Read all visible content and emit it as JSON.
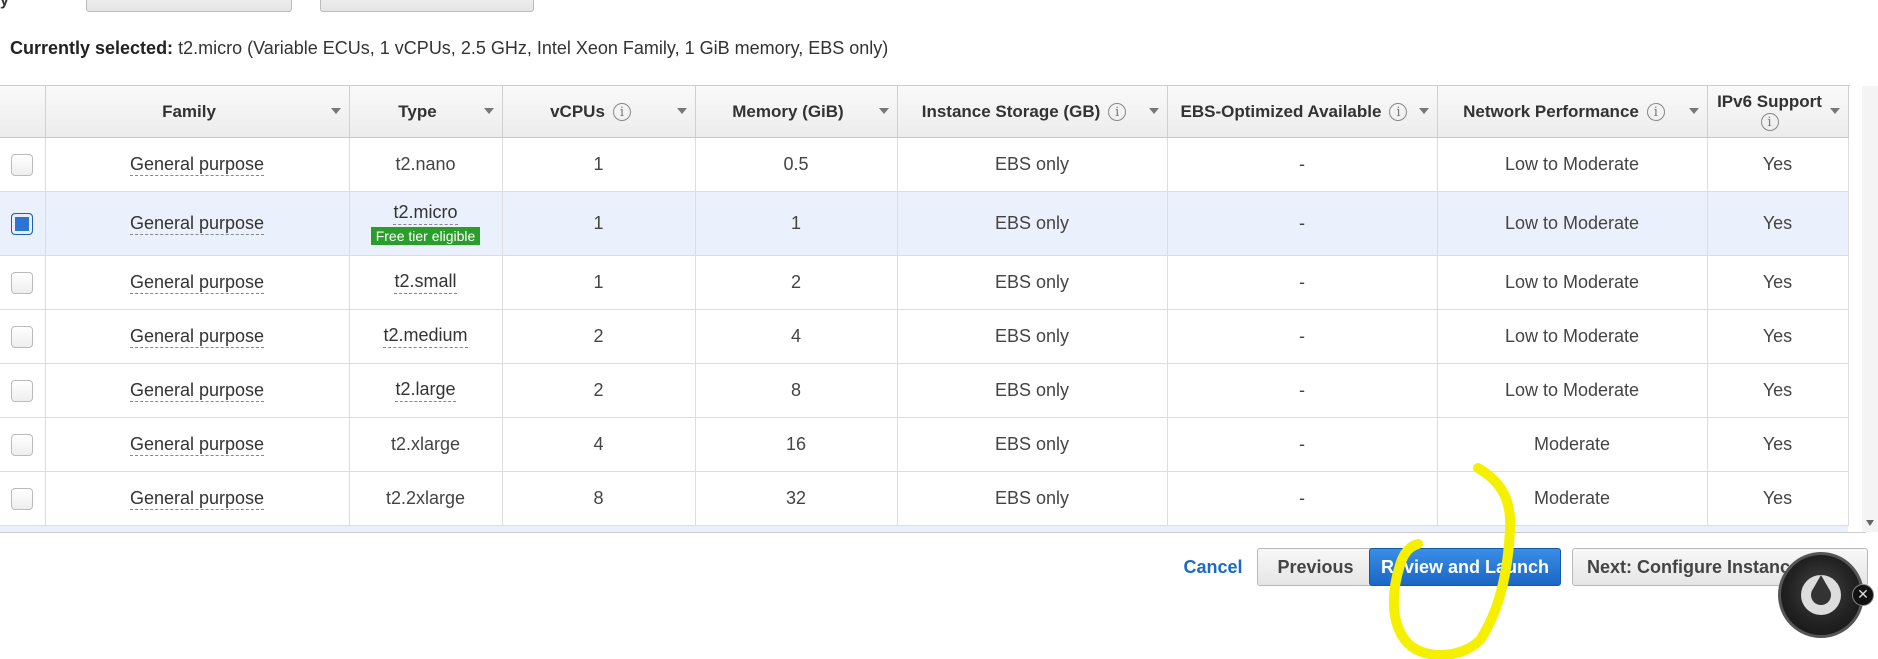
{
  "header": {
    "filter_label": "y"
  },
  "current_selection": {
    "label": "Currently selected:",
    "value": "t2.micro (Variable ECUs, 1 vCPUs, 2.5 GHz, Intel Xeon Family, 1 GiB memory, EBS only)"
  },
  "table": {
    "columns": [
      {
        "label": "Family",
        "info": false
      },
      {
        "label": "Type",
        "info": false
      },
      {
        "label": "vCPUs",
        "info": true
      },
      {
        "label": "Memory (GiB)",
        "info": false
      },
      {
        "label": "Instance Storage (GB)",
        "info": true
      },
      {
        "label": "EBS-Optimized Available",
        "info": true
      },
      {
        "label": "Network Performance",
        "info": true
      },
      {
        "label": "IPv6 Support",
        "info": true
      }
    ],
    "rows": [
      {
        "family": "General purpose",
        "type": "t2.nano",
        "vcpus": "1",
        "memory": "0.5",
        "storage": "EBS only",
        "ebs": "-",
        "network": "Low to Moderate",
        "ipv6": "Yes",
        "selected": false,
        "badge": ""
      },
      {
        "family": "General purpose",
        "type": "t2.micro",
        "vcpus": "1",
        "memory": "1",
        "storage": "EBS only",
        "ebs": "-",
        "network": "Low to Moderate",
        "ipv6": "Yes",
        "selected": true,
        "badge": "Free tier eligible"
      },
      {
        "family": "General purpose",
        "type": "t2.small",
        "vcpus": "1",
        "memory": "2",
        "storage": "EBS only",
        "ebs": "-",
        "network": "Low to Moderate",
        "ipv6": "Yes",
        "selected": false,
        "badge": ""
      },
      {
        "family": "General purpose",
        "type": "t2.medium",
        "vcpus": "2",
        "memory": "4",
        "storage": "EBS only",
        "ebs": "-",
        "network": "Low to Moderate",
        "ipv6": "Yes",
        "selected": false,
        "badge": ""
      },
      {
        "family": "General purpose",
        "type": "t2.large",
        "vcpus": "2",
        "memory": "8",
        "storage": "EBS only",
        "ebs": "-",
        "network": "Low to Moderate",
        "ipv6": "Yes",
        "selected": false,
        "badge": ""
      },
      {
        "family": "General purpose",
        "type": "t2.xlarge",
        "vcpus": "4",
        "memory": "16",
        "storage": "EBS only",
        "ebs": "-",
        "network": "Moderate",
        "ipv6": "Yes",
        "selected": false,
        "badge": ""
      },
      {
        "family": "General purpose",
        "type": "t2.2xlarge",
        "vcpus": "8",
        "memory": "32",
        "storage": "EBS only",
        "ebs": "-",
        "network": "Moderate",
        "ipv6": "Yes",
        "selected": false,
        "badge": ""
      }
    ]
  },
  "actions": {
    "cancel": "Cancel",
    "previous": "Previous",
    "review_launch": "Review and Launch",
    "next": "Next: Configure Instance"
  },
  "colors": {
    "primary_button": "#1a66c5",
    "badge_green": "#2a9d2a",
    "selected_row": "#eaf1fc",
    "annotation": "#f5f000"
  },
  "icons": {
    "info": "info-icon",
    "sort": "sort-caret-icon",
    "avatar": "avatar-icon",
    "close": "close-icon"
  }
}
